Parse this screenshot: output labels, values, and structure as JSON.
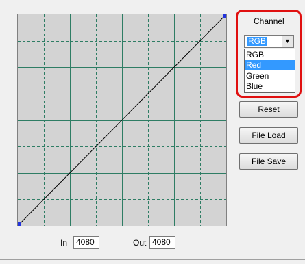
{
  "curve": {
    "grid_divisions": 8,
    "grid_color": "#2e7d64",
    "background": "#d3d3d3",
    "line_color": "#000000",
    "handle_color": "#2233dd"
  },
  "io": {
    "in_label": "In",
    "in_value": "4080",
    "out_label": "Out",
    "out_value": "4080"
  },
  "channel": {
    "label": "Channel",
    "selected": "RGB",
    "options": [
      "RGB",
      "Red",
      "Green",
      "Blue"
    ],
    "highlighted_option": "Red"
  },
  "buttons": {
    "reset": "Reset",
    "file_load": "File Load",
    "file_save": "File Save"
  },
  "annotation": {
    "highlight_color": "#e01010"
  }
}
